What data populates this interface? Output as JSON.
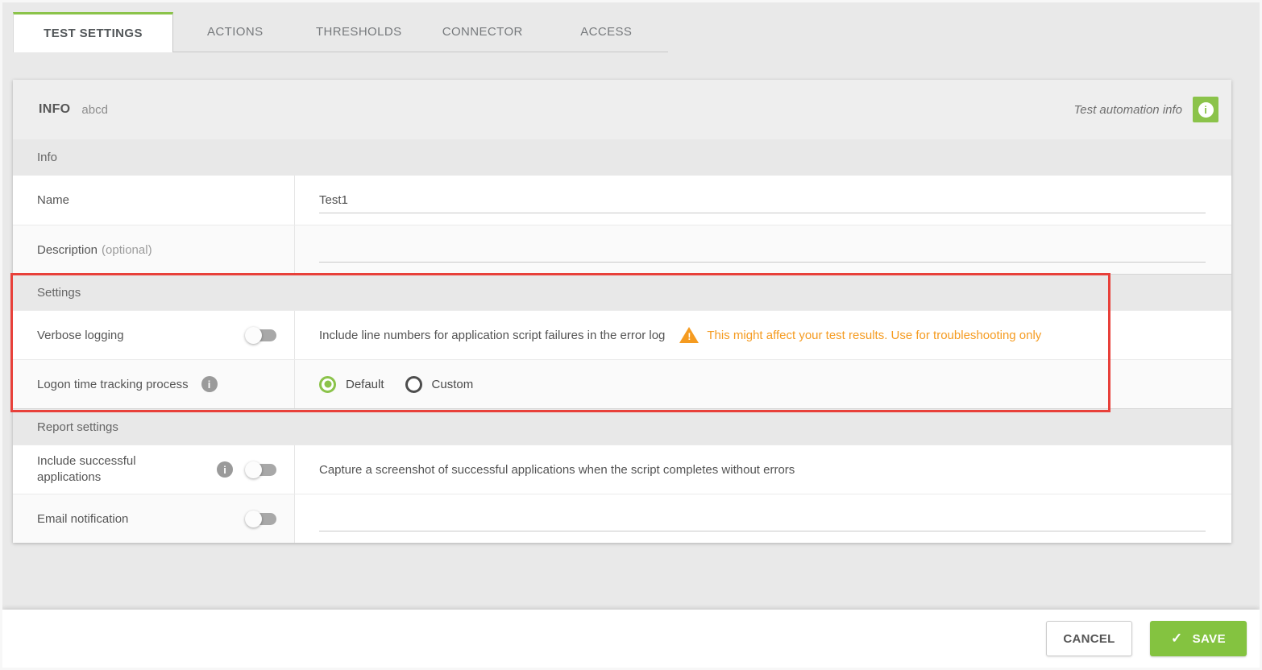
{
  "colors": {
    "accent_green": "#8bc34a",
    "save_green": "#84c340",
    "warning_orange": "#f59b20",
    "highlight_red": "#e8403a"
  },
  "tabs": [
    {
      "label": "TEST SETTINGS",
      "active": true
    },
    {
      "label": "ACTIONS",
      "active": false
    },
    {
      "label": "THRESHOLDS",
      "active": false
    },
    {
      "label": "CONNECTOR",
      "active": false
    },
    {
      "label": "ACCESS",
      "active": false
    }
  ],
  "header": {
    "title": "INFO",
    "subtitle": "abcd",
    "automation_label": "Test automation info",
    "info_icon": "i"
  },
  "section_info": {
    "title": "Info"
  },
  "name_row": {
    "label": "Name",
    "value": "Test1"
  },
  "description_row": {
    "label": "Description",
    "optional": "(optional)",
    "value": ""
  },
  "section_settings": {
    "title": "Settings"
  },
  "verbose_row": {
    "label": "Verbose logging",
    "toggle_state": "off",
    "description": "Include line numbers for application script failures in the error log",
    "warning": "This might affect your test results. Use for troubleshooting only"
  },
  "logon_row": {
    "label": "Logon time tracking process",
    "info_icon": "i",
    "options": {
      "default": "Default",
      "custom": "Custom"
    },
    "selected": "Default"
  },
  "section_report": {
    "title": "Report settings"
  },
  "include_row": {
    "label": "Include successful applications",
    "info_icon": "i",
    "toggle_state": "off",
    "description": "Capture a screenshot of successful applications when the script completes without errors"
  },
  "email_row": {
    "label": "Email notification",
    "toggle_state": "off",
    "value": ""
  },
  "footer": {
    "cancel": "CANCEL",
    "save": "SAVE",
    "check_icon": "✓"
  }
}
